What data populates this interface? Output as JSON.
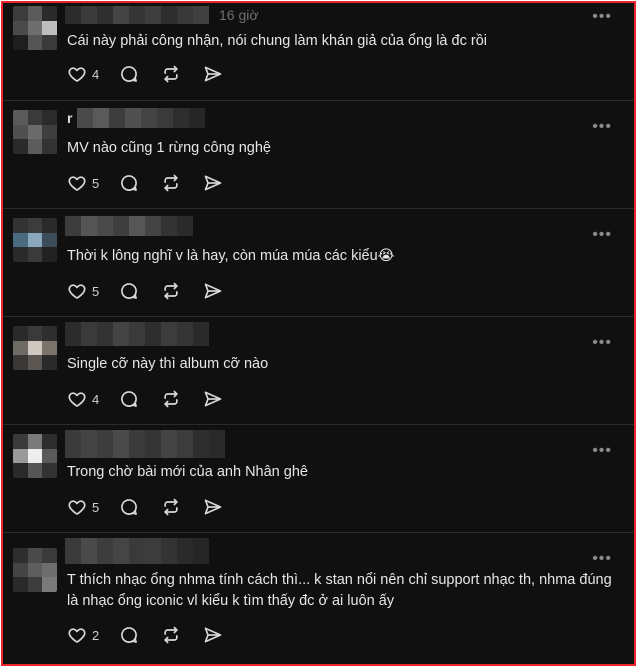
{
  "icons": {
    "like": "heart-icon",
    "reply": "comment-icon",
    "repost": "repost-icon",
    "share": "send-icon",
    "more": "more-icon"
  },
  "colors": {
    "background": "#101010",
    "border": "#e8262b",
    "text": "#e6e6e6",
    "muted": "#6f6f6f"
  },
  "posts": [
    {
      "time": "16 giờ",
      "name_initial": "",
      "text": "Cái này phải công nhận, nói chung làm khán giả của ổng là đc rồi",
      "likes": "4",
      "more": "•••"
    },
    {
      "time": "",
      "name_initial": "r",
      "text": "MV nào cũng 1 rừng công nghệ",
      "likes": "5",
      "more": "•••"
    },
    {
      "time": "",
      "name_initial": "",
      "text": "Thời k lông nghĩ v là hay, còn múa múa các kiểu😭",
      "likes": "5",
      "more": "•••"
    },
    {
      "time": "",
      "name_initial": "",
      "text": "Single cỡ này thì album cỡ nào",
      "likes": "4",
      "more": "•••"
    },
    {
      "time": "",
      "name_initial": "",
      "text": "Trong chờ bài mới của anh Nhân ghê",
      "likes": "5",
      "more": "•••"
    },
    {
      "time": "",
      "name_initial": "",
      "text": "T thích nhạc ổng    nhma tính cách thì... k stan nổi nên chỉ support nhạc th, nhma đúng là nhạc ổng iconic vl kiểu k tìm thấy đc ở ai luôn ấy",
      "likes": "2",
      "more": "•••"
    }
  ]
}
